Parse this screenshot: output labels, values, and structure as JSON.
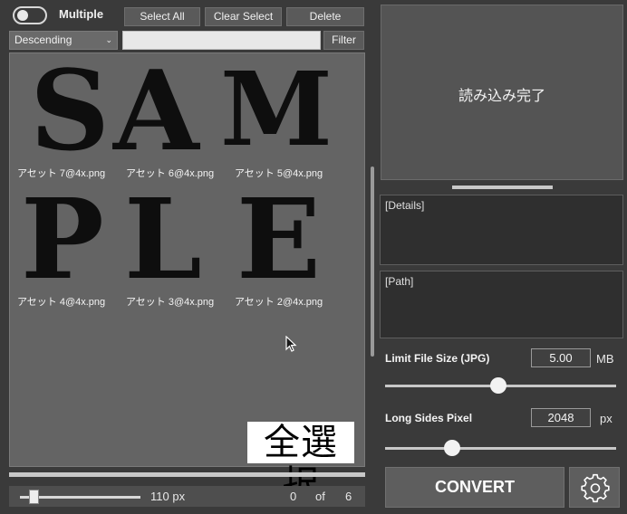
{
  "toolbar": {
    "multiple_label": "Multiple",
    "multiple_on": false,
    "select_all": "Select All",
    "clear_select": "Clear Select",
    "delete": "Delete",
    "sort_value": "Descending",
    "filter_placeholder": "",
    "filter_button": "Filter"
  },
  "watermark": {
    "row1": [
      "S",
      "A",
      "M"
    ],
    "row2": [
      "P",
      "L",
      "E"
    ]
  },
  "files": [
    {
      "name": "アセット 7@4x.png"
    },
    {
      "name": "アセット 6@4x.png"
    },
    {
      "name": "アセット 5@4x.png"
    },
    {
      "name": "アセット 4@4x.png"
    },
    {
      "name": "アセット 3@4x.png"
    },
    {
      "name": "アセット 2@4x.png"
    }
  ],
  "overlay_label": "全選択",
  "footer": {
    "thumb_size": "110 px",
    "selected": "0",
    "of": "of",
    "total": "6"
  },
  "preview": {
    "status": "読み込み完了"
  },
  "details_label": "[Details]",
  "path_label": "[Path]",
  "settings": {
    "limit_label": "Limit File Size (JPG)",
    "limit_value": "5.00",
    "limit_unit": "MB",
    "limit_level": 0.49,
    "long_label": "Long Sides Pixel",
    "long_value": "2048",
    "long_unit": "px",
    "long_level": 0.29
  },
  "convert_label": "CONVERT",
  "icons": {
    "gear": "gear-icon",
    "chevron": "chevron-down-icon",
    "cursor": "mouse-cursor-icon"
  }
}
